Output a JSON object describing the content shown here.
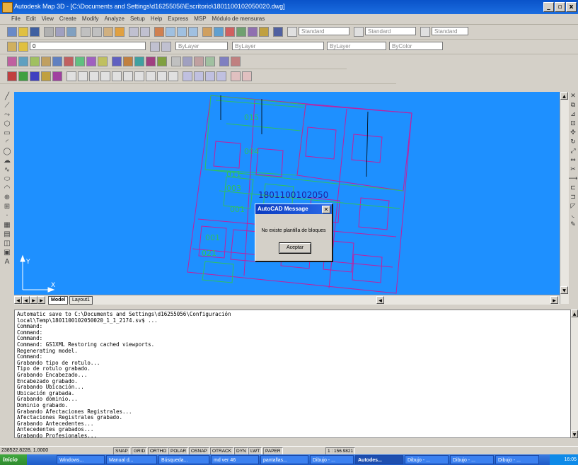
{
  "window": {
    "title": "Autodesk Map 3D - [C:\\Documents and Settings\\d16255056\\Escritorio\\1801100102050020.dwg]",
    "min_label": "_",
    "max_label": "▫",
    "close_label": "x"
  },
  "menubar": {
    "items": [
      "File",
      "Edit",
      "View",
      "Create",
      "Modify",
      "Analyze",
      "Setup",
      "Help",
      "Express",
      "MSP",
      "Módulo de mensuras"
    ]
  },
  "toolbars": {
    "layer_combo": "0",
    "style_combo_1": "Standard",
    "style_combo_2": "Standard",
    "style_combo_3": "Standard",
    "linetype_combo": "ByLayer",
    "lineweight_combo": "ByLayer",
    "color_combo": "ByColor",
    "layer_prop_combo": "ByLayer"
  },
  "drawing": {
    "parcel_ids": [
      "015",
      "004",
      "011",
      "003",
      "001",
      "001",
      "021"
    ],
    "center_label": "1801100102050"
  },
  "tabs": {
    "model": "Model",
    "layout": "Layout1"
  },
  "dialog": {
    "title": "AutoCAD Message",
    "message": "No existe plantilla de bloques",
    "button": "Aceptar"
  },
  "command_lines": [
    "Automatic save to C:\\Documents and Settings\\d16255056\\Configuración",
    "local\\Temp\\1801100102050020_1_1_2174.sv$ ...",
    "Command:",
    "Command:",
    "Command:",
    "Command: GS1XML Restoring cached viewports.",
    "Regenerating model.",
    "Command:",
    "Grabando tipo de rotulo...",
    "Tipo de rotulo grabado.",
    "Grabando Encabezado...",
    "Encabezado grabado.",
    "Grabando Ubicación...",
    "Ubicación grabada.",
    "Grabando dominio...",
    "Dominio grabado.",
    "Grabando Afectaciones Registrales...",
    "Afectaciones Registrales grabado.",
    "Grabando Antecedentes...",
    "Antecedentes grabados...",
    "Grabando Profesionales..."
  ],
  "status": {
    "coords": "238522.8228, 1.0000",
    "toggles": [
      "SNAP",
      "GRID",
      "ORTHO",
      "POLAR",
      "OSNAP",
      "OTRACK",
      "DYN",
      "LWT",
      "PAPER"
    ],
    "scale": "1 : 156.9821"
  },
  "taskbar": {
    "start": "Inicio",
    "tasks": [
      "Windows...",
      "Manual d...",
      "Búsqueda...",
      "md ver 46",
      "pantallas...",
      "Dibujo - ...",
      "Autodes...",
      "Dibujo - ...",
      "Dibujo - ...",
      "Dibujo - ..."
    ],
    "clock": "16:05"
  },
  "colors": {
    "drawing_bg": "#1e90ff",
    "parcel_magenta": "#c020a0",
    "parcel_green": "#30c060",
    "title_blue": "#0a53c9"
  }
}
